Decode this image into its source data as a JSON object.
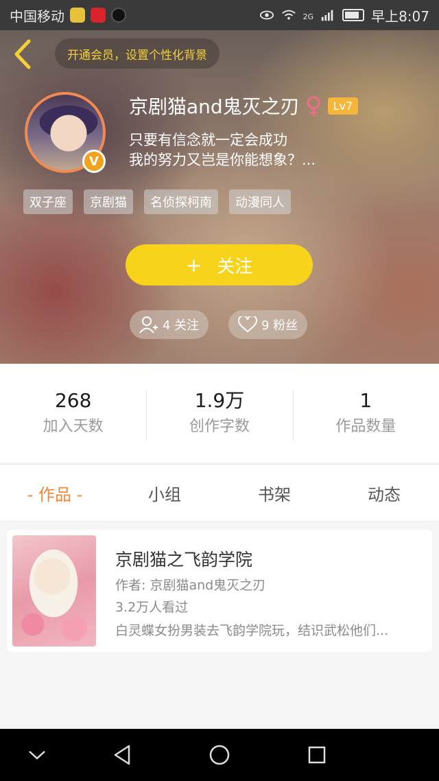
{
  "status_bar": {
    "carrier": "中国移动",
    "network": "2G",
    "time": "早上8:07",
    "icons": [
      "wechat-icon",
      "xiaohongshu-icon",
      "tiktok-icon",
      "eye-icon",
      "wifi-icon",
      "signal-icon",
      "battery-icon"
    ]
  },
  "header": {
    "vip_banner": "开通会员，设置个性化背景",
    "username": "京剧猫and鬼灭之刃",
    "gender_symbol": "♀",
    "level": "Lv7",
    "verified_badge": "V",
    "bio_lines": [
      "只要有信念就一定会成功",
      "我的努力又岂是你能想象？..."
    ],
    "tags": [
      "双子座",
      "京剧猫",
      "名侦探柯南",
      "动漫同人"
    ],
    "follow_button": {
      "icon": "+",
      "label": "关注"
    },
    "following": "4 关注",
    "fans": "9 粉丝"
  },
  "stats": [
    {
      "value": "268",
      "label": "加入天数"
    },
    {
      "value": "1.9万",
      "label": "创作字数"
    },
    {
      "value": "1",
      "label": "作品数量"
    }
  ],
  "tabs": [
    {
      "label": "- 作品 -",
      "active": true
    },
    {
      "label": "小组",
      "active": false
    },
    {
      "label": "书架",
      "active": false
    },
    {
      "label": "动态",
      "active": false
    }
  ],
  "works": [
    {
      "title": "京剧猫之飞韵学院",
      "author": "作者: 京剧猫and鬼灭之刃",
      "views": "3.2万人看过",
      "description": "白灵蝶女扮男装去飞韵学院玩，结识武松他们..."
    }
  ],
  "colors": {
    "accent_yellow": "#f7d31c",
    "active_tab": "#f0873a",
    "vip_text": "#f3d03a"
  }
}
